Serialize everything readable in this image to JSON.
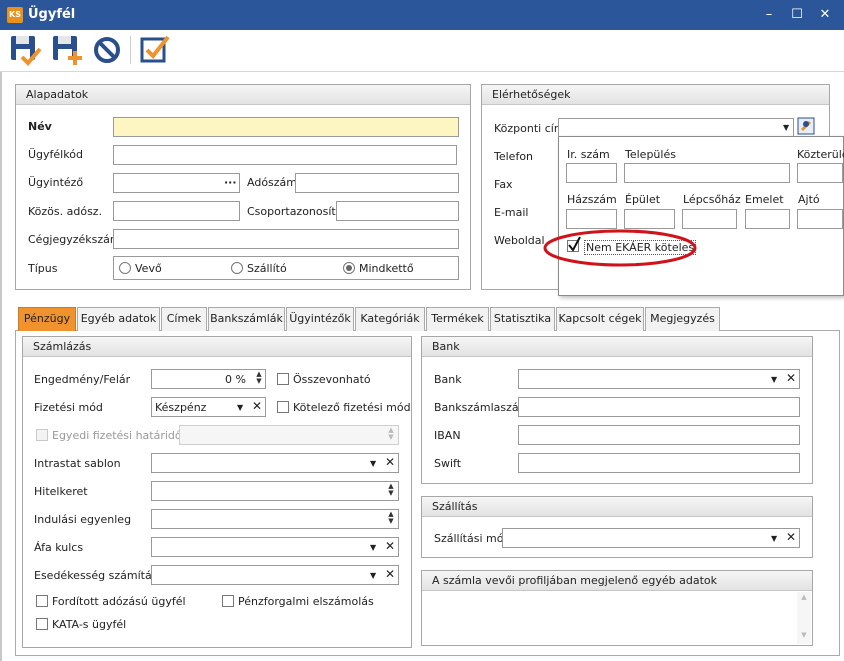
{
  "window": {
    "title": "Ügyfél",
    "logo": "KS",
    "minimize": "–",
    "maximize": "☐",
    "close": "✕"
  },
  "toolbar": {
    "icons": [
      "save-icon",
      "save-new-icon",
      "cancel-icon",
      "checklist-icon"
    ]
  },
  "alapadatok": {
    "title": "Alapadatok",
    "nev": "Név",
    "ugyfelkod": "Ügyfélkód",
    "ugyintezo": "Ügyintéző",
    "ugyintezo_dots": "···",
    "adoszam": "Adószám",
    "kozos_adosz": "Közös. adósz.",
    "csoportazonosito": "Csoportazonosító",
    "cegjegyzekszam": "Cégjegyzékszám",
    "tipus": "Típus",
    "radio_vevo": "Vevő",
    "radio_szallito": "Szállító",
    "radio_mindketto": "Mindkettő",
    "selected": "Mindkettő"
  },
  "elerhetosegek": {
    "title": "Elérhetőségek",
    "kozponti_cim": "Központi cím",
    "telefon": "Telefon",
    "fax": "Fax",
    "email": "E-mail",
    "weboldal": "Weboldal"
  },
  "popup": {
    "ir_szam": "Ir. szám",
    "telepules": "Település",
    "kozterulet": "Közterület",
    "hazszam": "Házszám",
    "epulet": "Épület",
    "lepcsohaz": "Lépcsőház",
    "emelet": "Emelet",
    "ajto": "Ajtó",
    "nem_ekaer": "Nem EKÁER köteles",
    "nem_ekaer_checked": true
  },
  "tabs": [
    "Pénzügy",
    "Egyéb adatok",
    "Címek",
    "Bankszámlák",
    "Ügyintézők",
    "Kategóriák",
    "Termékek",
    "Statisztika",
    "Kapcsolt cégek",
    "Megjegyzés"
  ],
  "active_tab": "Pénzügy",
  "szamlazas": {
    "title": "Számlázás",
    "engedmeny": "Engedmény/Felár",
    "engedmeny_value": "0 %",
    "osszevonhato": "Összevonható",
    "fizetesi_mod": "Fizetési mód",
    "fizetesi_mod_value": "Készpénz",
    "kotelezo_fizetesi_mod": "Kötelező fizetési mód",
    "egyedi_hatarido": "Egyedi fizetési határidő",
    "intrastat": "Intrastat sablon",
    "hitelkeret": "Hitelkeret",
    "indulasi": "Indulási egyenleg",
    "afa": "Áfa kulcs",
    "esedekesseg": "Esedékesség számítása",
    "forditott": "Fordított adózású ügyfél",
    "penzforgalmi": "Pénzforgalmi elszámolás",
    "kata": "KATA-s ügyfél"
  },
  "bank": {
    "title": "Bank",
    "bank": "Bank",
    "bankszamlaszam": "Bankszámlaszám",
    "iban": "IBAN",
    "swift": "Swift"
  },
  "szallitas": {
    "title": "Szállítás",
    "szallitasi_mod": "Szállítási mód"
  },
  "egyeb": {
    "title": "A számla vevői profiljában megjelenő egyéb adatok"
  },
  "colors": {
    "accent_tab": "#f0922e",
    "title_bar": "#2b579a",
    "required_field": "#fdf6c3",
    "highlight_ellipse": "#d0121b"
  }
}
